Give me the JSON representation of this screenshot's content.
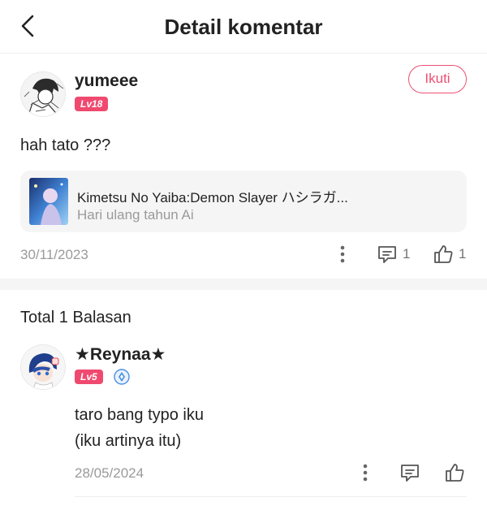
{
  "header": {
    "title": "Detail komentar",
    "back_icon": "chevron-left-icon"
  },
  "comment": {
    "username": "yumeee",
    "level": "Lv18",
    "follow_label": "Ikuti",
    "text": "hah tato ???",
    "card": {
      "title": "Kimetsu No Yaiba:Demon Slayer ハシラガ...",
      "subtitle": "Hari ulang tahun Ai"
    },
    "date": "30/11/2023",
    "reply_count": "1",
    "like_count": "1"
  },
  "replies": {
    "total_label": "Total 1 Balasan",
    "items": [
      {
        "username": "★Reynaa★",
        "level": "Lv5",
        "line1": "taro bang typo iku",
        "line2": "(iku artinya itu)",
        "date": "28/05/2024"
      }
    ]
  },
  "colors": {
    "accent": "#ec4f74",
    "badge": "#f0496f",
    "muted": "#9a9a9a",
    "divider": "#f5f5f5"
  }
}
